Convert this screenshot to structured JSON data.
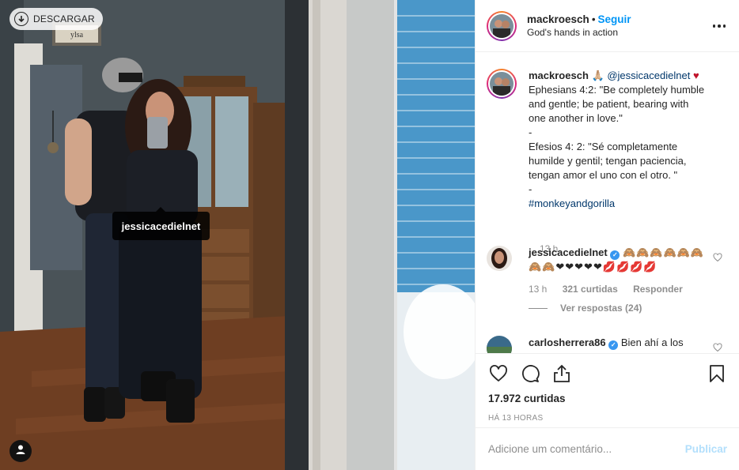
{
  "photo": {
    "download_label": "DESCARGAR",
    "tag_label": "jessicacedielnet",
    "sign_text": "ylsa"
  },
  "header": {
    "username": "mackroesch",
    "separator": "•",
    "follow_label": "Seguir",
    "location": "God's hands in action"
  },
  "caption": {
    "username": "mackroesch",
    "prefix_emojis": "🙏🏼",
    "mention": "@jessicacedielnet",
    "heart": "♥",
    "lines": [
      "Ephesians 4:2: \"Be completely humble",
      "and gentle; be patient, bearing with",
      "one another in love.\"",
      "-",
      "Efesios 4: 2: \"Sé completamente",
      "humilde y gentil; tengan paciencia,",
      "tengan amor el uno con el otro. \"",
      "-",
      "#monkeyandgorilla"
    ],
    "time": "13 h"
  },
  "comments": [
    {
      "username": "jessicacedielnet",
      "text_emojis": "🙈🙈🙈🙈🙈🙈",
      "text_emojis_2": "🙈🙈❤❤❤❤❤💋💋💋💋",
      "time": "13 h",
      "likes": "321 curtidas",
      "reply_label": "Responder",
      "view_replies": "Ver respostas (24)"
    },
    {
      "username": "carlosherrera86",
      "text": "Bien ahí a los"
    }
  ],
  "actions": {
    "likes": "17.972 curtidas",
    "time_ago": "HÁ 13 HORAS"
  },
  "add_comment": {
    "placeholder": "Adicione um comentário...",
    "publish_label": "Publicar"
  },
  "colors": {
    "accent": "#0095f6",
    "publish_disabled": "#b2dffc",
    "meta_gray": "#8e8e8e",
    "text": "#262626",
    "mention": "#00376b"
  },
  "icons": [
    "download-icon",
    "user-tag-icon",
    "more-options-icon",
    "heart-icon",
    "comment-icon",
    "share-icon",
    "save-icon",
    "verified-badge-icon"
  ]
}
